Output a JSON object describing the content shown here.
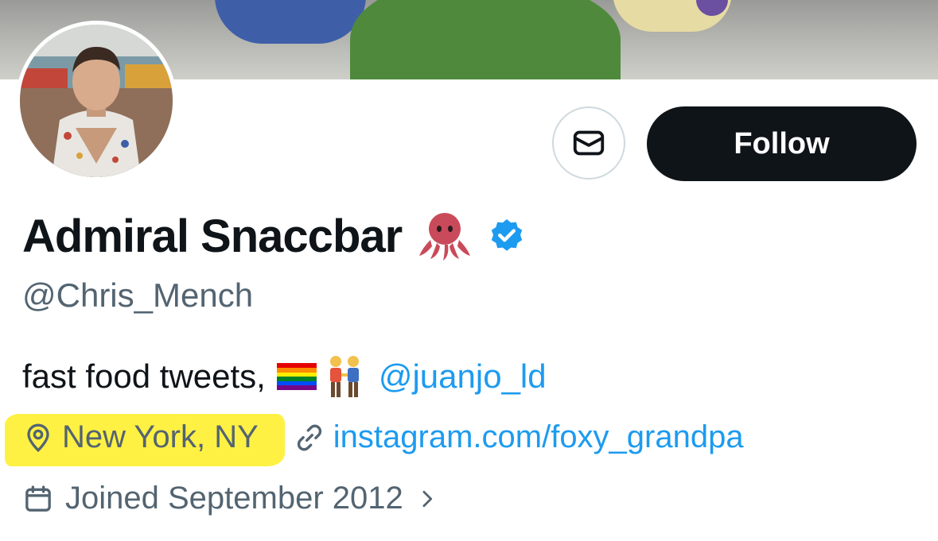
{
  "profile": {
    "display_name": "Admiral Snaccbar",
    "handle": "@Chris_Mench",
    "bio_text": "fast food tweets,",
    "bio_mention": "@juanjo_ld",
    "location": "New York, NY",
    "website": "instagram.com/foxy_grandpa",
    "joined": "Joined September 2012"
  },
  "actions": {
    "follow_label": "Follow"
  },
  "icons": {
    "message": "envelope-icon",
    "verified": "verified-badge-icon",
    "location": "location-pin-icon",
    "link": "link-icon",
    "calendar": "calendar-icon",
    "chevron": "chevron-right-icon"
  },
  "colors": {
    "accent": "#1d9bf0",
    "text_primary": "#0f1419",
    "text_secondary": "#536471",
    "follow_bg": "#0f1419",
    "highlight": "#fff03a"
  }
}
